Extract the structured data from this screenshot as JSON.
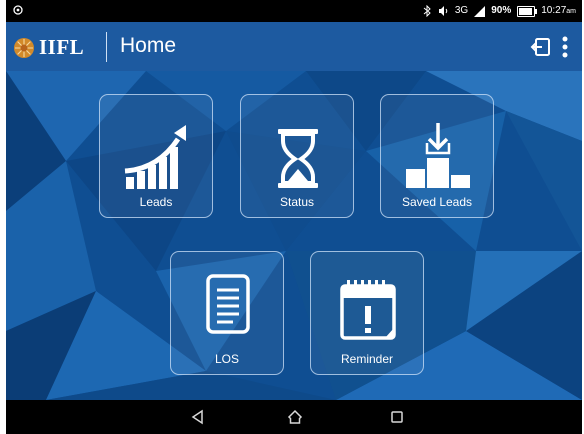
{
  "status_bar": {
    "network": "3G",
    "battery": "90%",
    "battery_level": 0.9,
    "time": "10:27",
    "time_suffix": "am"
  },
  "app_bar": {
    "logo": "IIFL",
    "title": "Home"
  },
  "tiles": [
    {
      "label": "Leads",
      "icon": "growth-chart-icon"
    },
    {
      "label": "Status",
      "icon": "hourglass-icon"
    },
    {
      "label": "Saved Leads",
      "icon": "download-podium-icon"
    },
    {
      "label": "LOS",
      "icon": "document-icon"
    },
    {
      "label": "Reminder",
      "icon": "calendar-alert-icon"
    }
  ],
  "colors": {
    "app_bar": "#1d5aa0",
    "background": "#0f4e92",
    "tile_border": "#cde1f8"
  }
}
